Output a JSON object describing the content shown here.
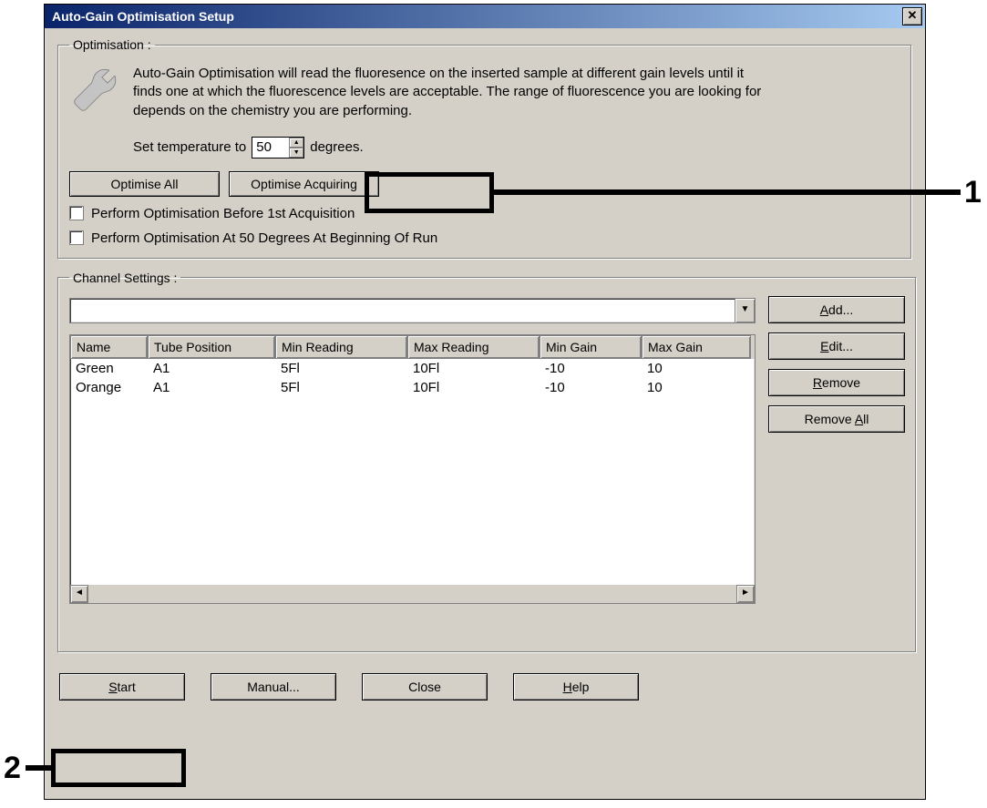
{
  "window": {
    "title": "Auto-Gain Optimisation Setup"
  },
  "optimisation": {
    "legend": "Optimisation :",
    "description": "Auto-Gain Optimisation will read the fluoresence on the inserted sample at different gain levels until it finds one at which the fluorescence levels are acceptable. The range of fluorescence you are looking for depends on the chemistry you are performing.",
    "temp_prefix": "Set temperature to ",
    "temp_value": "50",
    "temp_suffix": " degrees.",
    "btn_optimise_all": "Optimise All",
    "btn_optimise_acquiring": "Optimise Acquiring",
    "chk1_label": "Perform Optimisation Before 1st Acquisition",
    "chk2_label": "Perform Optimisation At 50 Degrees At Beginning Of Run"
  },
  "channel": {
    "legend": "Channel Settings :",
    "headers": {
      "name": "Name",
      "tube": "Tube Position",
      "minr": "Min Reading",
      "maxr": "Max Reading",
      "ming": "Min Gain",
      "maxg": "Max Gain"
    },
    "rows": [
      {
        "name": "Green",
        "tube": "A1",
        "minr": "5Fl",
        "maxr": "10Fl",
        "ming": "-10",
        "maxg": "10"
      },
      {
        "name": "Orange",
        "tube": "A1",
        "minr": "5Fl",
        "maxr": "10Fl",
        "ming": "-10",
        "maxg": "10"
      }
    ],
    "btn_add": "Add...",
    "btn_edit": "Edit...",
    "btn_remove": "Remove",
    "btn_remove_all": "Remove All"
  },
  "footer": {
    "start": "Start",
    "manual": "Manual...",
    "close": "Close",
    "help": "Help"
  },
  "callouts": {
    "one": "1",
    "two": "2"
  }
}
